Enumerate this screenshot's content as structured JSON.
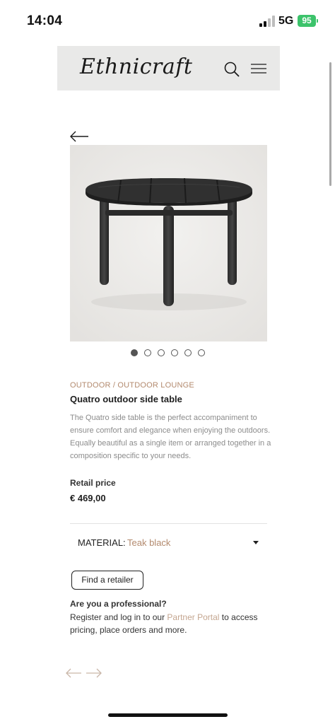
{
  "status": {
    "time": "14:04",
    "network": "5G",
    "battery": "95"
  },
  "header": {
    "logo": "Ethnicraft"
  },
  "carousel": {
    "slide_count": 6,
    "active_index": 0
  },
  "product": {
    "breadcrumb": "OUTDOOR / OUTDOOR LOUNGE",
    "title": "Quatro outdoor side table",
    "description": "The Quatro side table is the perfect accompaniment to ensure comfort and elegance when enjoying the outdoors. Equally beautiful as a single item or arranged together in a composition specific to your needs.",
    "price_label": "Retail price",
    "price": "€ 469,00"
  },
  "material": {
    "label": "MATERIAL:",
    "value": "Teak black"
  },
  "retailer": {
    "button_label": "Find a retailer"
  },
  "professional": {
    "question": "Are you a professional?",
    "text_before": "Register and log in to our ",
    "link_text": "Partner Portal",
    "text_after": " to access pricing, place orders and more."
  },
  "colors": {
    "accent": "#b38a6e",
    "header_bg": "#e9e9e8",
    "battery": "#3cc36b"
  },
  "icons": [
    "signal-icon",
    "search-icon",
    "menu-icon",
    "back-arrow-icon",
    "prev-arrow-icon",
    "next-arrow-icon"
  ]
}
